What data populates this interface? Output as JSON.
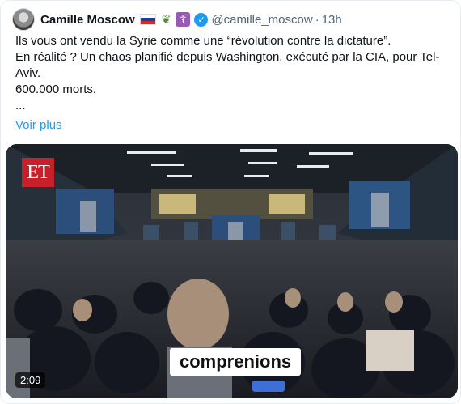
{
  "tweet": {
    "author_name": "Camille Moscow",
    "handle": "@camille_moscow",
    "separator": "·",
    "time": "13h",
    "icons": [
      "russia-flag-icon",
      "olive-branch-icon",
      "orthodox-cross-icon",
      "verified-badge-icon"
    ],
    "text_lines": [
      "Ils vous ont vendu la Syrie comme une “révolution contre la dictature”.",
      "En réalité ? Un chaos planifié depuis Washington, exécuté par la CIA, pour Tel-Aviv.",
      "600.000 morts.",
      "..."
    ],
    "show_more": "Voir plus"
  },
  "video": {
    "logo_text": "ET",
    "caption": "comprenions",
    "duration": "2:09"
  },
  "colors": {
    "link": "#1d9bf0",
    "muted": "#536471",
    "et_red": "#c8202b"
  }
}
